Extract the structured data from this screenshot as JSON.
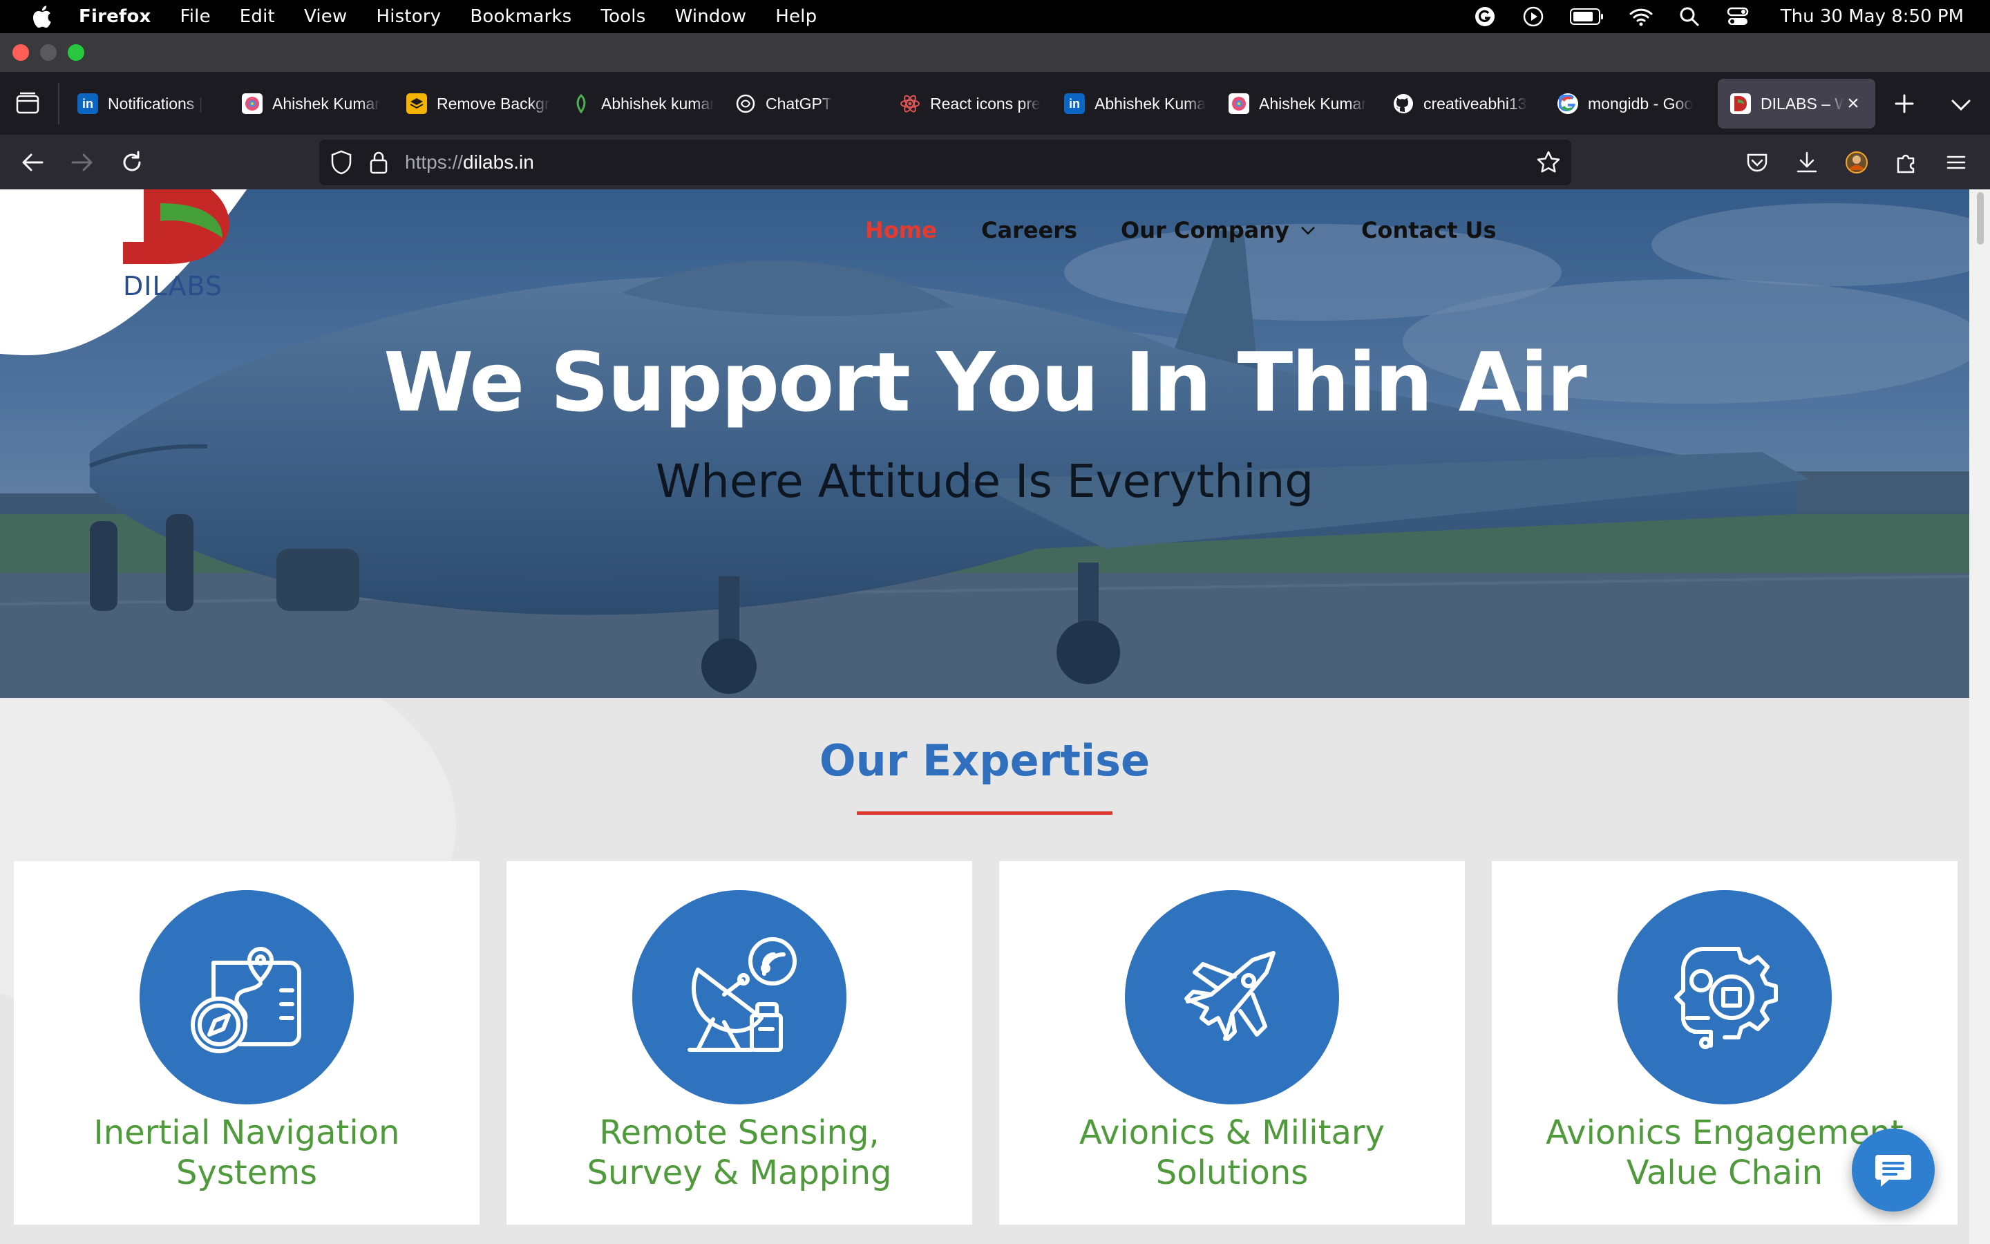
{
  "menubar": {
    "app": "Firefox",
    "items": [
      "File",
      "Edit",
      "View",
      "History",
      "Bookmarks",
      "Tools",
      "Window",
      "Help"
    ],
    "clock": "Thu 30 May  8:50 PM"
  },
  "tabs": [
    {
      "label": "Notifications |",
      "icon": "linkedin-icon",
      "color": "#0a66c2"
    },
    {
      "label": "Ahishek Kumar",
      "icon": "figma-icon",
      "color": "#ffffff"
    },
    {
      "label": "Remove Backgr",
      "icon": "remove-bg-icon",
      "color": "#f5b400"
    },
    {
      "label": "Abhishek kumar",
      "icon": "leaf-icon",
      "color": "#4caf50"
    },
    {
      "label": "ChatGPT",
      "icon": "chatgpt-icon",
      "color": "#ffffff"
    },
    {
      "label": "React icons pre",
      "icon": "react-icon",
      "color": "#e25555"
    },
    {
      "label": "Abhishek Kuma",
      "icon": "linkedin-icon",
      "color": "#0a66c2"
    },
    {
      "label": "Ahishek Kumar",
      "icon": "figma-icon",
      "color": "#ffffff"
    },
    {
      "label": "creativeabhi13",
      "icon": "github-icon",
      "color": "#ffffff"
    },
    {
      "label": "mongidb - Goo",
      "icon": "google-icon",
      "color": "#ffffff"
    },
    {
      "label": "DILABS – W",
      "icon": "dilabs-icon",
      "color": "#ffffff"
    }
  ],
  "urlbar": {
    "protocol": "https://",
    "host": "dilabs.in"
  },
  "site": {
    "logo_text": "DILABS",
    "nav": [
      "Home",
      "Careers",
      "Our Company",
      "Contact Us"
    ],
    "hero_title": "We Support You In Thin Air",
    "hero_subtitle": "Where Attitude Is Everything",
    "expertise_title": "Our Expertise",
    "cards": [
      {
        "line1": "Inertial Navigation",
        "line2": "Systems",
        "icon": "navigation-map-icon"
      },
      {
        "line1": "Remote Sensing,",
        "line2": "Survey & Mapping",
        "icon": "satellite-dish-icon"
      },
      {
        "line1": "Avionics & Military",
        "line2": "Solutions",
        "icon": "fighter-jet-icon"
      },
      {
        "line1": "Avionics Engagement",
        "line2": "Value Chain",
        "icon": "robot-gear-icon"
      }
    ]
  },
  "colors": {
    "nav_active": "#e73a2f",
    "expertise_title": "#2f6fbd",
    "icon_circle": "#2f72bd",
    "card_label": "#4f9a3a",
    "underline": "#dd3a31"
  }
}
